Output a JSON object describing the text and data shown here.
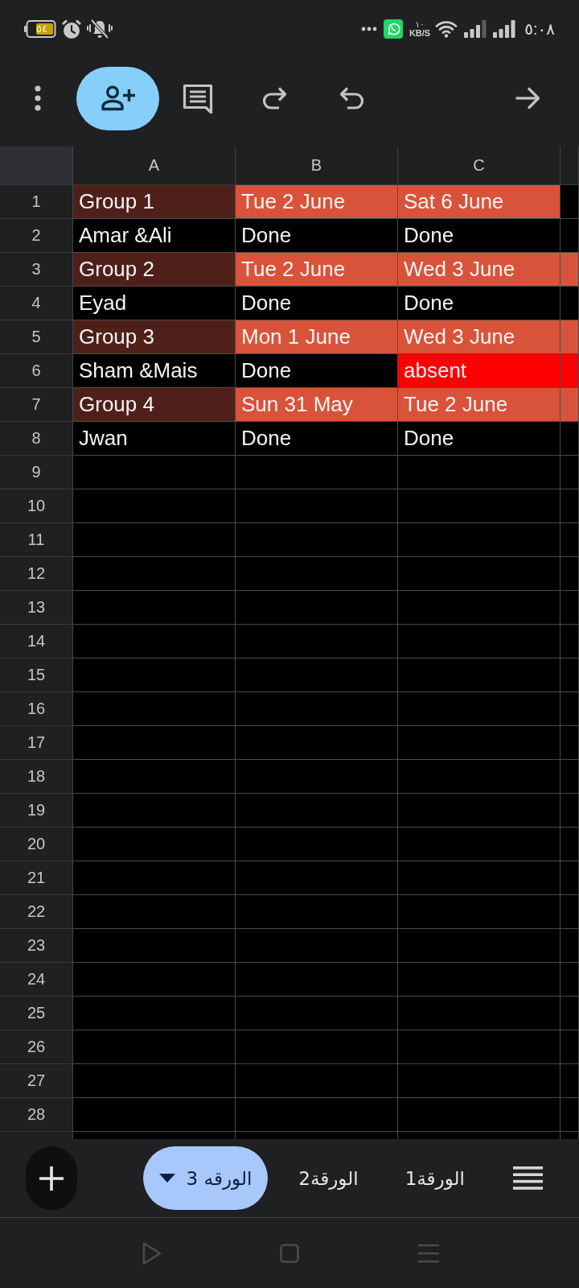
{
  "status_bar": {
    "battery": "٥٤",
    "network_speed": "١٠",
    "network_speed_unit": "KB/S",
    "time": "٥:٠٨"
  },
  "sheet": {
    "columns": [
      "A",
      "B",
      "C"
    ],
    "rows": [
      {
        "number": "1",
        "cells": [
          {
            "text": "Group 1",
            "color": "#4f201a"
          },
          {
            "text": "Tue 2 June",
            "color": "#d9533a"
          },
          {
            "text": "Sat 6 June",
            "color": "#d9533a"
          }
        ]
      },
      {
        "number": "2",
        "cells": [
          {
            "text": "Amar &Ali"
          },
          {
            "text": "Done"
          },
          {
            "text": "Done"
          }
        ]
      },
      {
        "number": "3",
        "cells": [
          {
            "text": "Group 2",
            "color": "#4f201a"
          },
          {
            "text": "Tue 2 June",
            "color": "#d9533a"
          },
          {
            "text": "Wed 3 June",
            "color": "#d9533a"
          },
          {
            "color": "#d9533a"
          }
        ]
      },
      {
        "number": "4",
        "cells": [
          {
            "text": "Eyad"
          },
          {
            "text": "Done"
          },
          {
            "text": "Done"
          }
        ]
      },
      {
        "number": "5",
        "cells": [
          {
            "text": "Group 3",
            "color": "#4f201a"
          },
          {
            "text": "Mon 1 June",
            "color": "#d9533a"
          },
          {
            "text": "Wed 3 June",
            "color": "#d9533a"
          },
          {
            "color": "#d9533a"
          }
        ]
      },
      {
        "number": "6",
        "cells": [
          {
            "text": "Sham &Mais"
          },
          {
            "text": "Done"
          },
          {
            "text": "absent",
            "color": "#ff0000"
          },
          {
            "color": "#ff0000"
          }
        ]
      },
      {
        "number": "7",
        "cells": [
          {
            "text": "Group 4",
            "color": "#4f201a"
          },
          {
            "text": "Sun 31 May",
            "color": "#d9533a"
          },
          {
            "text": "Tue 2 June",
            "color": "#d9533a"
          },
          {
            "color": "#d9533a"
          }
        ]
      },
      {
        "number": "8",
        "cells": [
          {
            "text": "Jwan"
          },
          {
            "text": "Done"
          },
          {
            "text": "Done"
          }
        ]
      },
      {
        "number": "9"
      },
      {
        "number": "10"
      },
      {
        "number": "11"
      },
      {
        "number": "12"
      },
      {
        "number": "13"
      },
      {
        "number": "14"
      },
      {
        "number": "15"
      },
      {
        "number": "16"
      },
      {
        "number": "17"
      },
      {
        "number": "18"
      },
      {
        "number": "19"
      },
      {
        "number": "20"
      },
      {
        "number": "21"
      },
      {
        "number": "22"
      },
      {
        "number": "23"
      },
      {
        "number": "24"
      },
      {
        "number": "25"
      },
      {
        "number": "26"
      },
      {
        "number": "27"
      },
      {
        "number": "28"
      }
    ]
  },
  "sheet_tabs": [
    {
      "label": "الورقة1",
      "selected": false
    },
    {
      "label": "الورقة2",
      "selected": false
    },
    {
      "label": "الورقه 3",
      "selected": true
    }
  ]
}
